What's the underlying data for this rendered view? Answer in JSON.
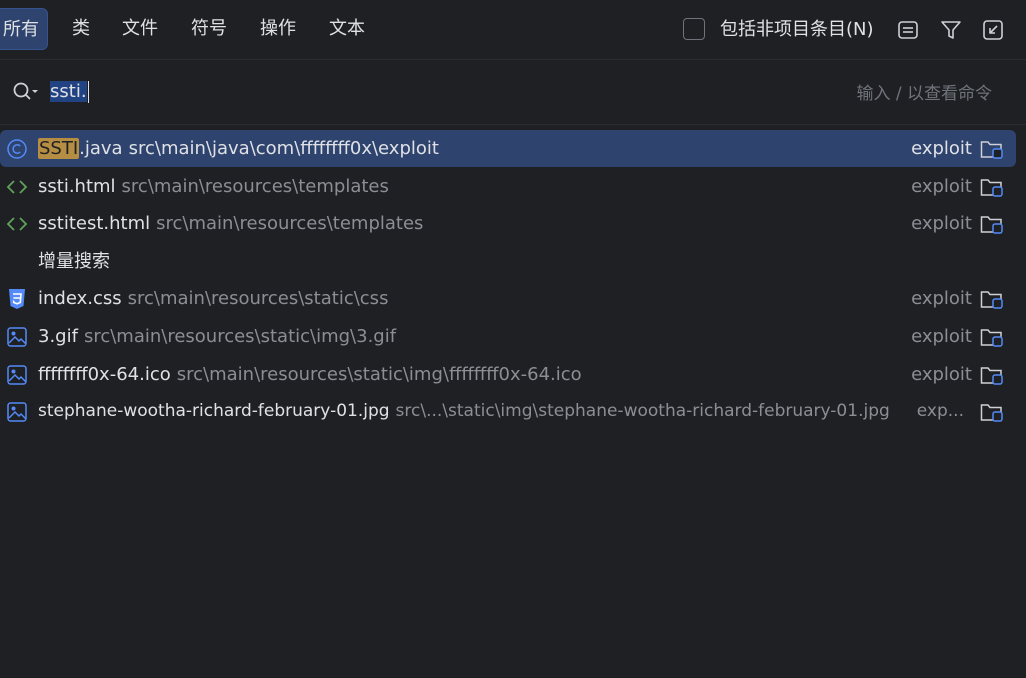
{
  "tabs": [
    "所有",
    "类",
    "文件",
    "符号",
    "操作",
    "文本"
  ],
  "active_tab": "所有",
  "include_non_project": {
    "label": "包括非项目条目(N)",
    "checked": false
  },
  "toolbar_icons": [
    "preview-icon",
    "filter-icon",
    "open-in-window-icon"
  ],
  "search": {
    "query": "ssti.",
    "hint": "输入 / 以查看命令"
  },
  "results": [
    {
      "icon": "class-icon",
      "match": "SSTI",
      "rest": ".java",
      "path": "src\\main\\java\\com\\ffffffff0x\\exploit",
      "module": "exploit",
      "selected": true
    },
    {
      "icon": "html-icon",
      "match": "",
      "rest": "ssti.html",
      "path": "src\\main\\resources\\templates",
      "module": "exploit",
      "selected": false
    },
    {
      "icon": "html-icon",
      "match": "",
      "rest": "sstitest.html",
      "path": "src\\main\\resources\\templates",
      "module": "exploit",
      "selected": false
    }
  ],
  "incremental_label": "增量搜索",
  "incremental_results": [
    {
      "icon": "css-icon",
      "name": "index.css",
      "path": "src\\main\\resources\\static\\css",
      "module": "exploit"
    },
    {
      "icon": "image-icon",
      "name": "3.gif",
      "path": "src\\main\\resources\\static\\img\\3.gif",
      "module": "exploit"
    },
    {
      "icon": "image-icon",
      "name": "ffffffff0x-64.ico",
      "path": "src\\main\\resources\\static\\img\\ffffffff0x-64.ico",
      "module": "exploit"
    },
    {
      "icon": "image-icon",
      "name": "stephane-wootha-richard-february-01.jpg",
      "path": "src\\...\\static\\img\\stephane-wootha-richard-february-01.jpg",
      "module": "exp..."
    }
  ],
  "colors": {
    "background": "#1f2024",
    "selection": "#2e436e",
    "match_highlight": "#b58d43",
    "html_icon": "#5fa35a",
    "file_icon_blue": "#548af7"
  }
}
